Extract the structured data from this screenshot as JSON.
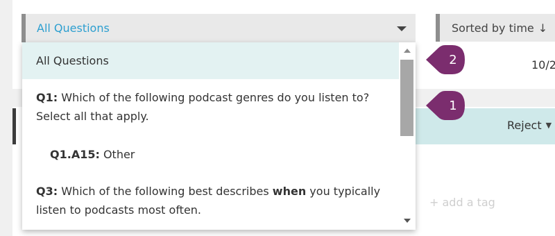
{
  "question_filter": {
    "selected": "All Questions",
    "options": {
      "all": "All Questions",
      "q1_prefix": "Q1:",
      "q1_text": " Which of the following podcast genres do you listen to? Select all that apply.",
      "a15_prefix": "Q1.A15:",
      "a15_text": " Other",
      "q3_prefix": "Q3:",
      "q3_text_before": " Which of the following best describes ",
      "q3_emphasis": "when",
      "q3_text_after": " you typically listen to podcasts most often."
    }
  },
  "sort": {
    "label": "Sorted by time",
    "arrow": "↓"
  },
  "response": {
    "date_fragment": "10/2",
    "reject_label": "Reject",
    "add_tag": "+ add a tag"
  },
  "callouts": {
    "first": "1",
    "second": "2",
    "color": "#7b2d6e"
  },
  "colors": {
    "link_blue": "#2d9fd0",
    "highlight_teal": "#e3f2f2",
    "bar_teal": "#cfe9ea"
  }
}
